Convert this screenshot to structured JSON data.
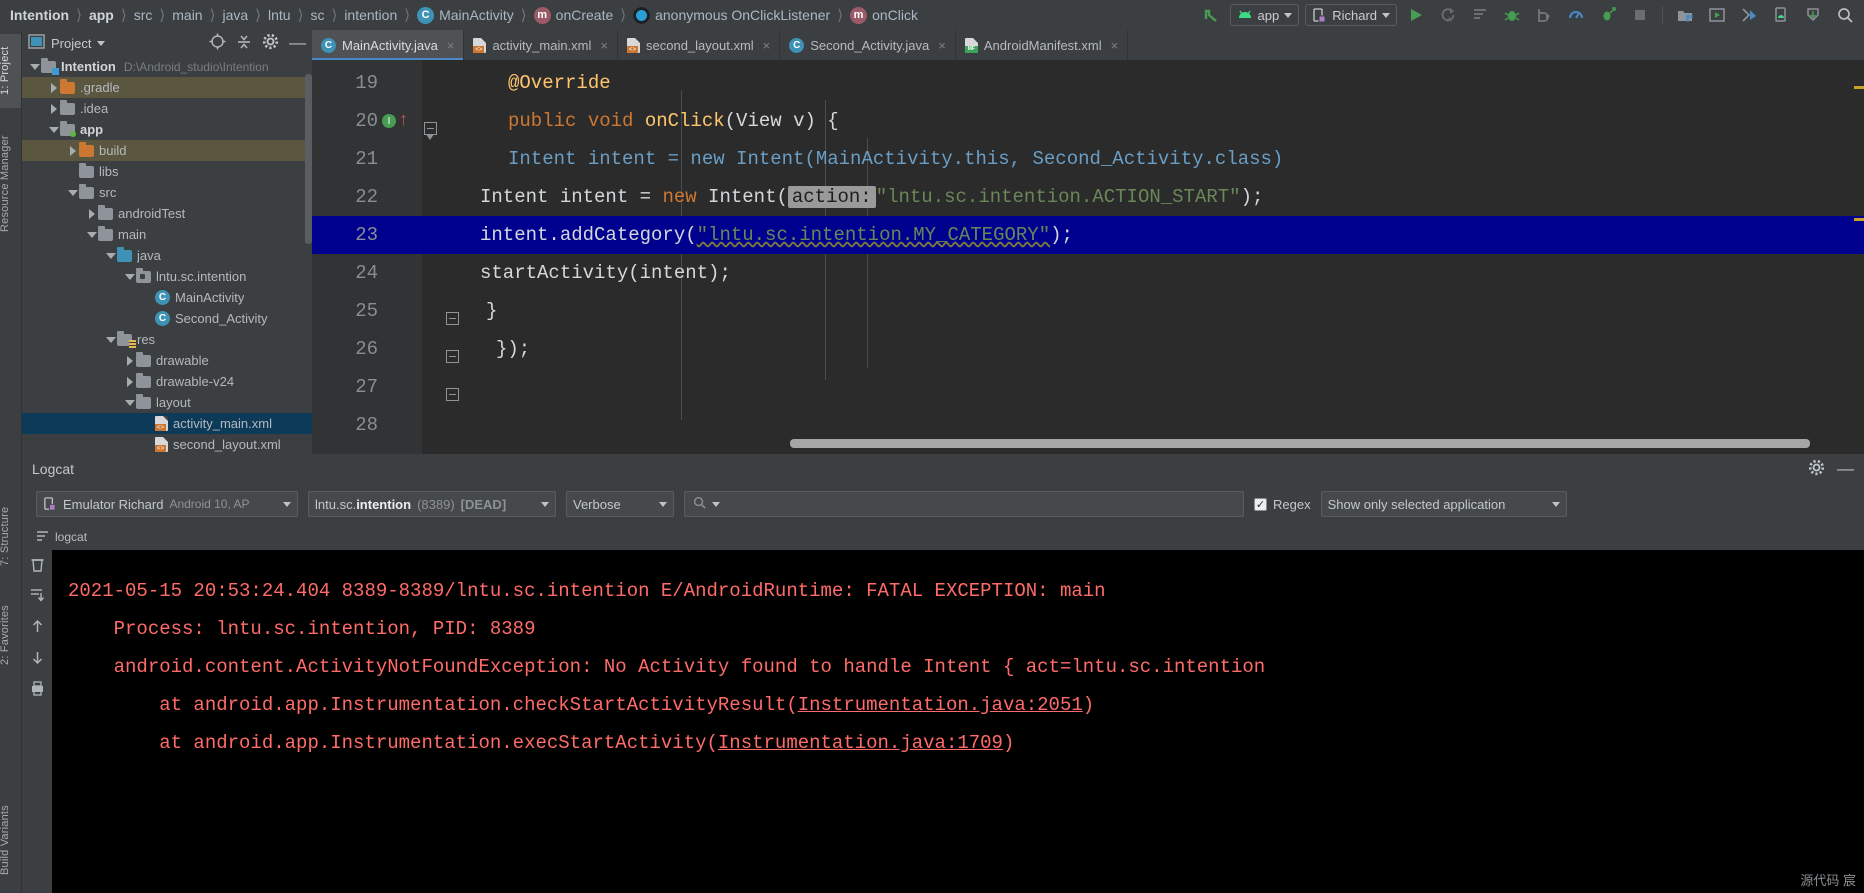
{
  "breadcrumb": [
    {
      "label": "Intention",
      "icon": "none",
      "bold": true
    },
    {
      "label": "app",
      "icon": "none",
      "bold": true
    },
    {
      "label": "src",
      "icon": "none",
      "bold": false
    },
    {
      "label": "main",
      "icon": "none",
      "bold": false
    },
    {
      "label": "java",
      "icon": "none",
      "bold": false
    },
    {
      "label": "lntu",
      "icon": "none",
      "bold": false
    },
    {
      "label": "sc",
      "icon": "none",
      "bold": false
    },
    {
      "label": "intention",
      "icon": "none",
      "bold": false
    },
    {
      "label": "MainActivity",
      "icon": "class-icon",
      "bold": false
    },
    {
      "label": "onCreate",
      "icon": "method-icon",
      "bold": false
    },
    {
      "label": "anonymous OnClickListener",
      "icon": "anonymous-class-icon",
      "bold": false
    },
    {
      "label": "onClick",
      "icon": "method-icon",
      "bold": false
    }
  ],
  "toolbar": {
    "module_selector": "app",
    "device_selector": "Richard",
    "icons": [
      "back-arrow-icon",
      "run-icon",
      "rerun-icon",
      "apply-changes-icon",
      "debug-icon",
      "debug-attach-icon",
      "profiler-icon",
      "attach-debugger-icon",
      "stop-icon",
      "sdk-manager-icon",
      "avd-manager-icon",
      "layout-inspector-icon",
      "device-file-explorer-icon",
      "sync-gradle-icon",
      "search-icon"
    ]
  },
  "left_strips": [
    {
      "label": "1: Project",
      "selected": true
    },
    {
      "label": "Resource Manager",
      "selected": false
    },
    {
      "label": "7: Structure",
      "selected": false
    },
    {
      "label": "2: Favorites",
      "selected": false
    },
    {
      "label": "Build Variants",
      "selected": false
    }
  ],
  "project_panel": {
    "title": "Project",
    "header_icons": [
      "locate-icon",
      "collapse-all-icon",
      "settings-gear-icon",
      "minimize-icon"
    ],
    "tree": [
      {
        "indent": 0,
        "twisty": "open",
        "icon": "project-folder-icon",
        "label": "Intention",
        "bold": true,
        "path": "D:\\Android_studio\\Intention",
        "state": "normal"
      },
      {
        "indent": 1,
        "twisty": "closed",
        "icon": "folder-orange-icon",
        "label": ".gradle",
        "bold": false,
        "path": "",
        "state": "highlight"
      },
      {
        "indent": 1,
        "twisty": "closed",
        "icon": "folder-icon",
        "label": ".idea",
        "bold": false,
        "path": "",
        "state": "normal"
      },
      {
        "indent": 1,
        "twisty": "open",
        "icon": "module-folder-icon",
        "label": "app",
        "bold": true,
        "path": "",
        "state": "normal"
      },
      {
        "indent": 2,
        "twisty": "closed",
        "icon": "folder-orange-icon",
        "label": "build",
        "bold": false,
        "path": "",
        "state": "highlight"
      },
      {
        "indent": 2,
        "twisty": "none",
        "icon": "folder-icon",
        "label": "libs",
        "bold": false,
        "path": "",
        "state": "normal"
      },
      {
        "indent": 2,
        "twisty": "open",
        "icon": "folder-icon",
        "label": "src",
        "bold": false,
        "path": "",
        "state": "normal"
      },
      {
        "indent": 3,
        "twisty": "closed",
        "icon": "folder-icon",
        "label": "androidTest",
        "bold": false,
        "path": "",
        "state": "normal"
      },
      {
        "indent": 3,
        "twisty": "open",
        "icon": "folder-icon",
        "label": "main",
        "bold": false,
        "path": "",
        "state": "normal"
      },
      {
        "indent": 4,
        "twisty": "open",
        "icon": "folder-blue-icon",
        "label": "java",
        "bold": false,
        "path": "",
        "state": "normal"
      },
      {
        "indent": 5,
        "twisty": "open",
        "icon": "package-folder-icon",
        "label": "lntu.sc.intention",
        "bold": false,
        "path": "",
        "state": "normal"
      },
      {
        "indent": 6,
        "twisty": "none",
        "icon": "java-class-icon",
        "label": "MainActivity",
        "bold": false,
        "path": "",
        "state": "normal"
      },
      {
        "indent": 6,
        "twisty": "none",
        "icon": "java-class-icon",
        "label": "Second_Activity",
        "bold": false,
        "path": "",
        "state": "normal"
      },
      {
        "indent": 4,
        "twisty": "open",
        "icon": "res-folder-icon",
        "label": "res",
        "bold": false,
        "path": "",
        "state": "normal"
      },
      {
        "indent": 5,
        "twisty": "closed",
        "icon": "folder-icon",
        "label": "drawable",
        "bold": false,
        "path": "",
        "state": "normal"
      },
      {
        "indent": 5,
        "twisty": "closed",
        "icon": "folder-icon",
        "label": "drawable-v24",
        "bold": false,
        "path": "",
        "state": "normal"
      },
      {
        "indent": 5,
        "twisty": "open",
        "icon": "folder-icon",
        "label": "layout",
        "bold": false,
        "path": "",
        "state": "normal"
      },
      {
        "indent": 6,
        "twisty": "none",
        "icon": "xml-file-icon",
        "label": "activity_main.xml",
        "bold": false,
        "path": "",
        "state": "selected"
      },
      {
        "indent": 6,
        "twisty": "none",
        "icon": "xml-file-icon",
        "label": "second_layout.xml",
        "bold": false,
        "path": "",
        "state": "normal"
      }
    ]
  },
  "editor": {
    "tabs": [
      {
        "label": "MainActivity.java",
        "icon": "java-class-icon",
        "active": true,
        "close": "×"
      },
      {
        "label": "activity_main.xml",
        "icon": "xml-file-icon",
        "active": false,
        "close": "×"
      },
      {
        "label": "second_layout.xml",
        "icon": "xml-file-icon",
        "active": false,
        "close": "×"
      },
      {
        "label": "Second_Activity.java",
        "icon": "java-class-icon",
        "active": false,
        "close": "×"
      },
      {
        "label": "AndroidManifest.xml",
        "icon": "manifest-file-icon",
        "active": false,
        "close": "×"
      }
    ],
    "lines": [
      {
        "num": "19",
        "current": false,
        "marks": []
      },
      {
        "num": "20",
        "current": false,
        "marks": [
          "intention-bulb-icon",
          "override-arrow-icon",
          "fold-icon"
        ]
      },
      {
        "num": "21",
        "current": false,
        "marks": []
      },
      {
        "num": "22",
        "current": false,
        "marks": []
      },
      {
        "num": "23",
        "current": true,
        "marks": []
      },
      {
        "num": "24",
        "current": false,
        "marks": []
      },
      {
        "num": "25",
        "current": false,
        "marks": [
          "fold-icon"
        ]
      },
      {
        "num": "26",
        "current": false,
        "marks": [
          "fold-icon"
        ]
      },
      {
        "num": "27",
        "current": false,
        "marks": [
          "fold-icon"
        ]
      },
      {
        "num": "28",
        "current": false,
        "marks": []
      }
    ],
    "code": {
      "l19": "@Override",
      "l20_kw": "public void ",
      "l20_meth": "onClick",
      "l20_rest": "(View v) {",
      "l21": "Intent intent = new Intent(MainActivity.this, Second_Activity.class)",
      "l22_a": "Intent intent = ",
      "l22_kw": "new",
      "l22_b": " Intent(",
      "l22_hint": "action:",
      "l22_str": "\"lntu.sc.intention.ACTION_START\"",
      "l22_c": ");",
      "l23_a": "intent.addCategory(",
      "l23_str": "\"lntu.sc.intention.MY_CATEGORY\"",
      "l23_b": ");",
      "l24": "startActivity(intent);",
      "l25": "}",
      "l26": "});"
    }
  },
  "logcat": {
    "title": "Logcat",
    "header_icons": [
      "settings-gear-icon",
      "minimize-icon"
    ],
    "device": "Emulator Richard",
    "device_detail": "Android 10, AP",
    "process": "lntu.sc.intention",
    "process_pid": "(8389)",
    "process_state": "[DEAD]",
    "level": "Verbose",
    "search_placeholder": "",
    "regex_label": "Regex",
    "regex_checked": true,
    "scope": "Show only selected application",
    "subtab": "logcat",
    "strip_icons": [
      "clear-logcat-icon",
      "scroll-to-end-icon",
      "up-arrow-icon",
      "down-arrow-icon",
      "print-icon"
    ],
    "output": [
      "2021-05-15 20:53:24.404 8389-8389/lntu.sc.intention E/AndroidRuntime: FATAL EXCEPTION: main",
      "    Process: lntu.sc.intention, PID: 8389",
      "    android.content.ActivityNotFoundException: No Activity found to handle Intent { act=lntu.sc.intention",
      "        at android.app.Instrumentation.checkStartActivityResult(Instrumentation.java:2051)",
      "        at android.app.Instrumentation.execStartActivity(Instrumentation.java:1709)"
    ],
    "output_links": [
      "Instrumentation.java:2051",
      "Instrumentation.java:1709"
    ]
  },
  "status": {
    "watermark": "源代码 宸"
  },
  "colors": {
    "accent": "#4a88c7",
    "selection": "#00008f",
    "error": "#ff6b68",
    "string": "#6a8759",
    "keyword": "#cc7832",
    "method": "#ffc66d"
  }
}
